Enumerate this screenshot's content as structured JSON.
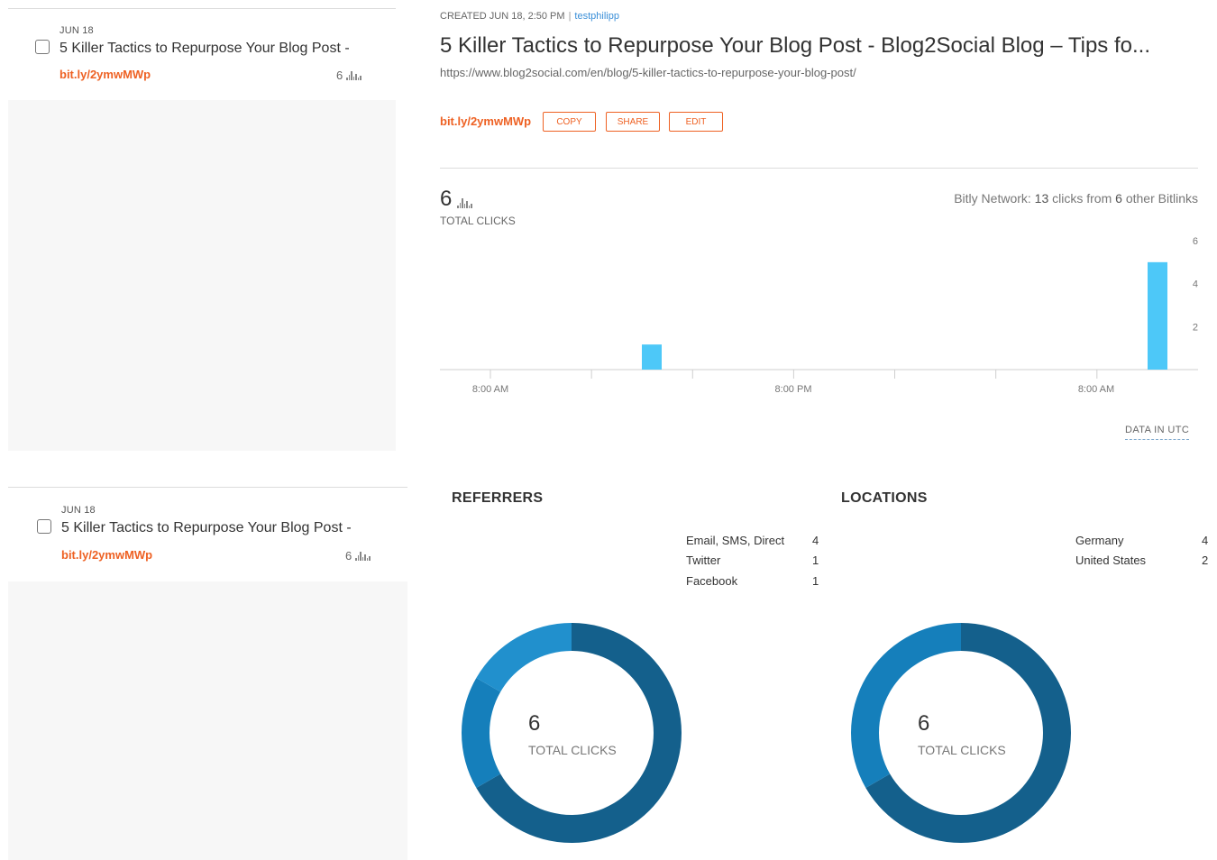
{
  "list": {
    "cards": [
      {
        "date": "JUN 18",
        "title": "5 Killer Tactics to Repurpose Your Blog Post -",
        "link": "bit.ly/2ymwMWp",
        "clicks": "6"
      },
      {
        "date": "JUN 18",
        "title": "5 Killer Tactics to Repurpose Your Blog Post -",
        "link": "bit.ly/2ymwMWp",
        "clicks": "6"
      }
    ]
  },
  "detail": {
    "created": "CREATED JUN 18, 2:50 PM",
    "separator": "|",
    "user": "testphilipp",
    "title": "5 Killer Tactics to Repurpose Your Blog Post - Blog2Social Blog – Tips fo...",
    "url": "https://www.blog2social.com/en/blog/5-killer-tactics-to-repurpose-your-blog-post/",
    "short_link": "bit.ly/2ymwMWp",
    "buttons": {
      "copy": "COPY",
      "share": "SHARE",
      "edit": "EDIT"
    },
    "total_clicks": "6",
    "total_clicks_label": "TOTAL CLICKS",
    "network": {
      "prefix": "Bitly Network:",
      "clicks": "13",
      "mid": "clicks from",
      "count": "6",
      "suffix": "other Bitlinks"
    },
    "data_note": "DATA IN UTC"
  },
  "chart_data": {
    "type": "bar",
    "x_tick_labels": [
      "8:00 AM",
      "8:00 PM",
      "8:00 AM"
    ],
    "y_tick_labels": [
      "2",
      "4",
      "6"
    ],
    "ylim": [
      0,
      6
    ],
    "x_range": [
      0,
      30
    ],
    "bars": [
      {
        "x": 15,
        "value": 1,
        "color": "#4dc8f8"
      },
      {
        "x": 29,
        "value": 5,
        "color": "#4dc8f8"
      }
    ],
    "x_ticks": [
      0,
      5,
      10,
      15,
      20,
      25,
      30
    ]
  },
  "referrers": {
    "title": "REFERRERS",
    "items": [
      {
        "name": "Email, SMS, Direct",
        "value": "4",
        "color": "#14608c"
      },
      {
        "name": "Twitter",
        "value": "1",
        "color": "#157fbb"
      },
      {
        "name": "Facebook",
        "value": "1",
        "color": "#2190cd"
      }
    ],
    "total": "6",
    "total_label": "TOTAL CLICKS"
  },
  "locations": {
    "title": "LOCATIONS",
    "items": [
      {
        "name": "Germany",
        "value": "4",
        "color": "#14608c"
      },
      {
        "name": "United States",
        "value": "2",
        "color": "#157fbb"
      }
    ],
    "total": "6",
    "total_label": "TOTAL CLICKS"
  }
}
